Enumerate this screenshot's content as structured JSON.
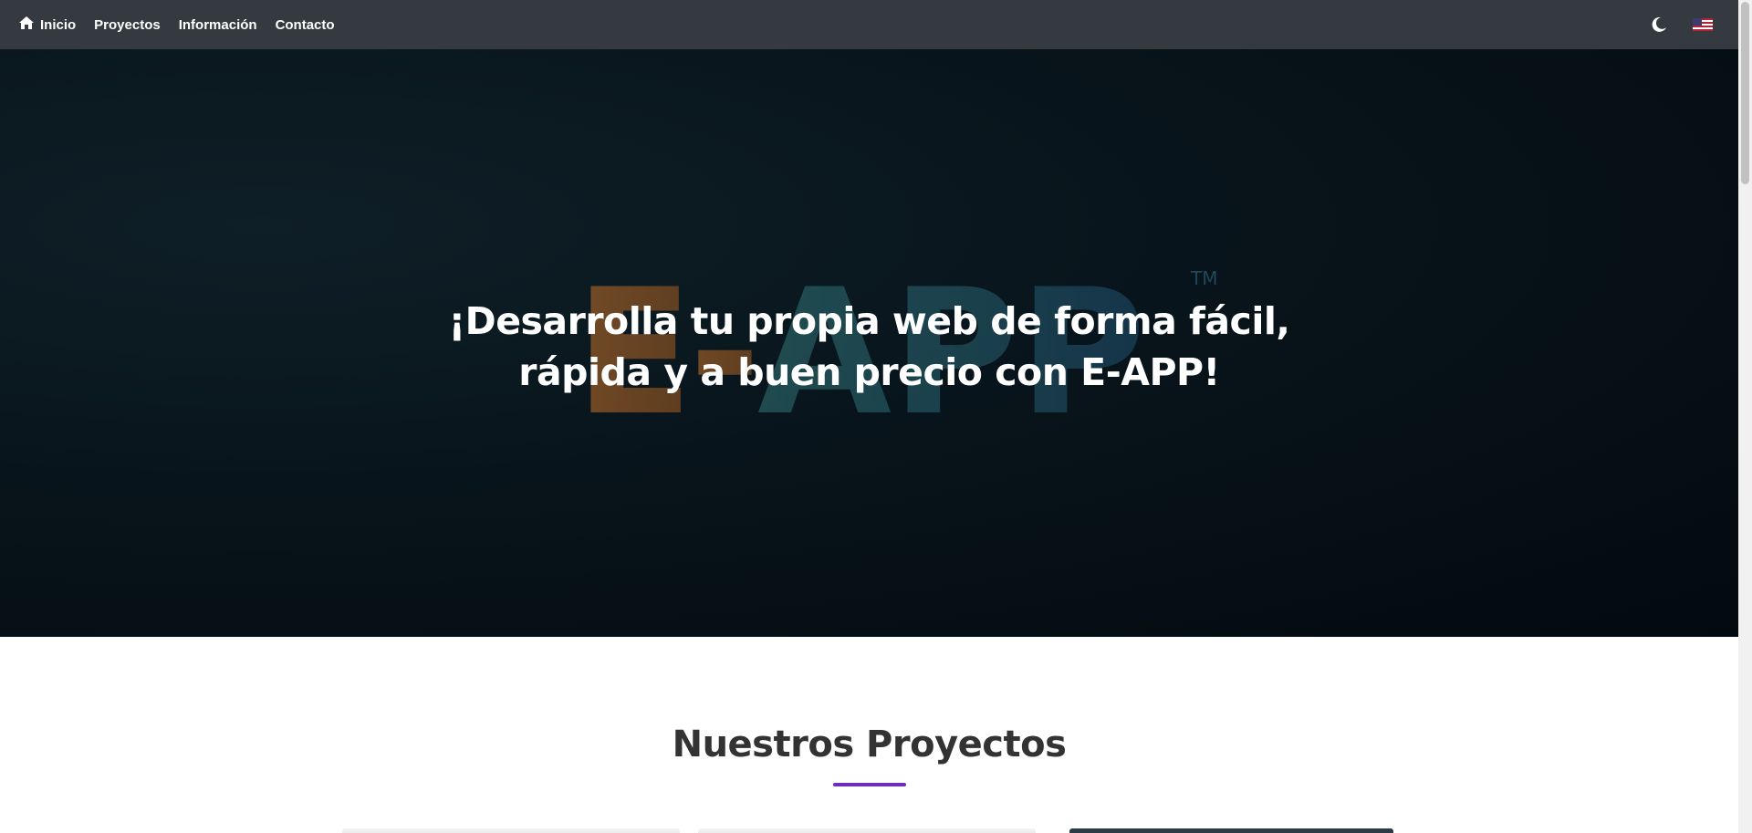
{
  "nav": {
    "home_label": "Inicio",
    "links": [
      "Proyectos",
      "Información",
      "Contacto"
    ]
  },
  "hero": {
    "title_line1": "¡Desarrolla tu propia web de forma fácil,",
    "title_line2": "rápida y a buen precio con E-APP!",
    "logo_text": "E-APP",
    "logo_tm": "TM"
  },
  "projects": {
    "title": "Nuestros Proyectos"
  },
  "colors": {
    "navbar": "#343a40",
    "accent": "#6f2dbd",
    "logo_orange": "#c8742a",
    "logo_teal": "#3a8a8a"
  }
}
